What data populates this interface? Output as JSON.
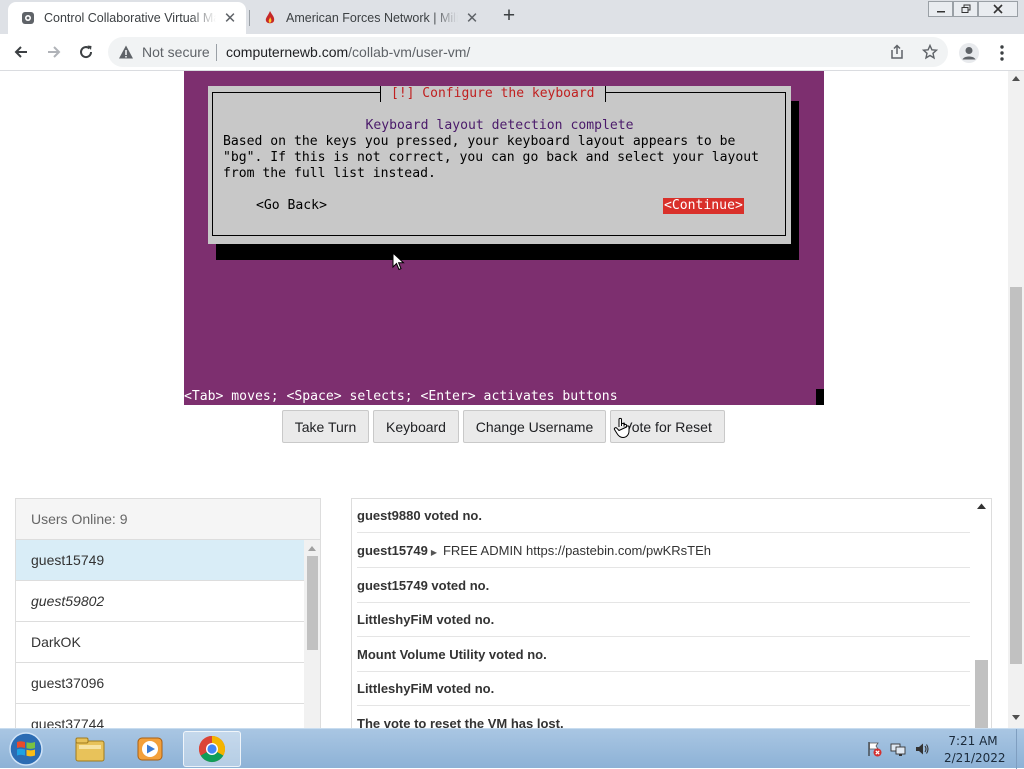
{
  "browser": {
    "tabs": [
      {
        "title": "Control Collaborative Virtual Machines",
        "active": true
      },
      {
        "title": "American Forces Network | Military",
        "active": false
      }
    ],
    "new_tab": "+",
    "close_glyph": "✕",
    "not_secure": "Not secure",
    "url_host": "computernewb.com",
    "url_path": "/collab-vm/user-vm/"
  },
  "vm": {
    "dialog_title": "[!] Configure the keyboard",
    "heading": "Keyboard layout detection complete",
    "body_lines": [
      "Based on the keys you pressed, your keyboard layout appears to be",
      "\"bg\". If this is not correct, you can go back and select your layout",
      "from the full list instead."
    ],
    "go_back": "<Go Back>",
    "continue": "<Continue>",
    "status_line": "<Tab> moves; <Space> selects; <Enter> activates buttons",
    "colors": {
      "background": "#7d2f6f",
      "dialog": "#c8c8c8",
      "selected": "#d9302a"
    }
  },
  "controls": {
    "take_turn": "Take Turn",
    "keyboard": "Keyboard",
    "change_username": "Change Username",
    "vote_reset": "Vote for Reset"
  },
  "users": {
    "header": "Users Online: 9",
    "list": [
      "guest15749",
      "guest59802",
      "DarkOK",
      "guest37096",
      "guest37744"
    ]
  },
  "chat": {
    "messages": [
      {
        "user": "guest9880 voted no.",
        "text": ""
      },
      {
        "user": "guest15749",
        "text": "FREE ADMIN https://pastebin.com/pwKRsTEh"
      },
      {
        "user": "guest15749 voted no.",
        "text": ""
      },
      {
        "user": "LittleshyFiM voted no.",
        "text": ""
      },
      {
        "user": "Mount Volume Utility voted no.",
        "text": ""
      },
      {
        "user": "LittleshyFiM voted no.",
        "text": ""
      },
      {
        "user": "The vote to reset the VM has lost.",
        "text": ""
      }
    ]
  },
  "taskbar": {
    "apps": [
      "explorer-icon",
      "media-player-icon",
      "chrome-icon"
    ],
    "time": "7:21 AM",
    "date": "2/21/2022"
  }
}
